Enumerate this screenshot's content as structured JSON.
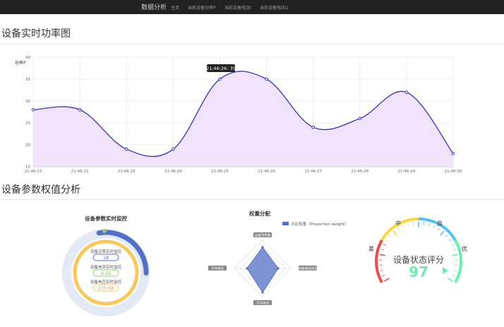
{
  "navbar": {
    "brand": "数据分析",
    "items": [
      "主页",
      "当前设备功率P",
      "当前设备电流I",
      "当前设备电压U"
    ]
  },
  "sections": {
    "power_title": "设备实时功率图",
    "weights_title": "设备参数权值分析"
  },
  "chart_data": [
    {
      "type": "area",
      "ylabel": "功率P",
      "x": [
        "21:46:22",
        "21:46:22",
        "21:46:23",
        "21:46:24",
        "21:46:25",
        "21:46:26",
        "21:46:27",
        "21:46:28",
        "21:46:29",
        "21:46:30"
      ],
      "values": [
        28,
        28,
        19,
        19,
        35,
        35,
        24,
        26,
        32,
        18
      ],
      "ylim": [
        15,
        40
      ],
      "yticks": [
        15,
        20,
        25,
        30,
        35,
        40
      ],
      "tooltip": "21:46:26: 35",
      "line_color": "#3333cc",
      "fill_color": "#f1e3fb",
      "grid": true
    },
    {
      "type": "radar",
      "title": "权重分配",
      "legend": "占比权重（Proportion weight）",
      "axes": [
        "设备功率图",
        "设备电压状态",
        "平均电流",
        "平均电压"
      ],
      "values": [
        0.75,
        0.55,
        0.85,
        0.55
      ],
      "color": "#5470c6"
    }
  ],
  "monitor": {
    "title": "设备参数实时监控",
    "items": [
      {
        "label": "设备功率实时监控",
        "value": "18",
        "color": "#5470c6"
      },
      {
        "label": "设备电流实时监控",
        "value": "0.15",
        "color": "#91cc75"
      },
      {
        "label": "设备电压实时监控",
        "value": "235.68",
        "color": "#fac858"
      }
    ],
    "colors": {
      "outer": "#5470c6",
      "green": "#91cc75",
      "orange": "#fac858",
      "bg": "#e3e9f5"
    }
  },
  "gauge": {
    "title": "设备状态评分",
    "value": "97",
    "score": 97,
    "labels": [
      "差",
      "中",
      "良",
      "优"
    ],
    "colors": [
      "#ee4c4c",
      "#fdd835",
      "#4fc3f7",
      "#69f0ae"
    ]
  }
}
